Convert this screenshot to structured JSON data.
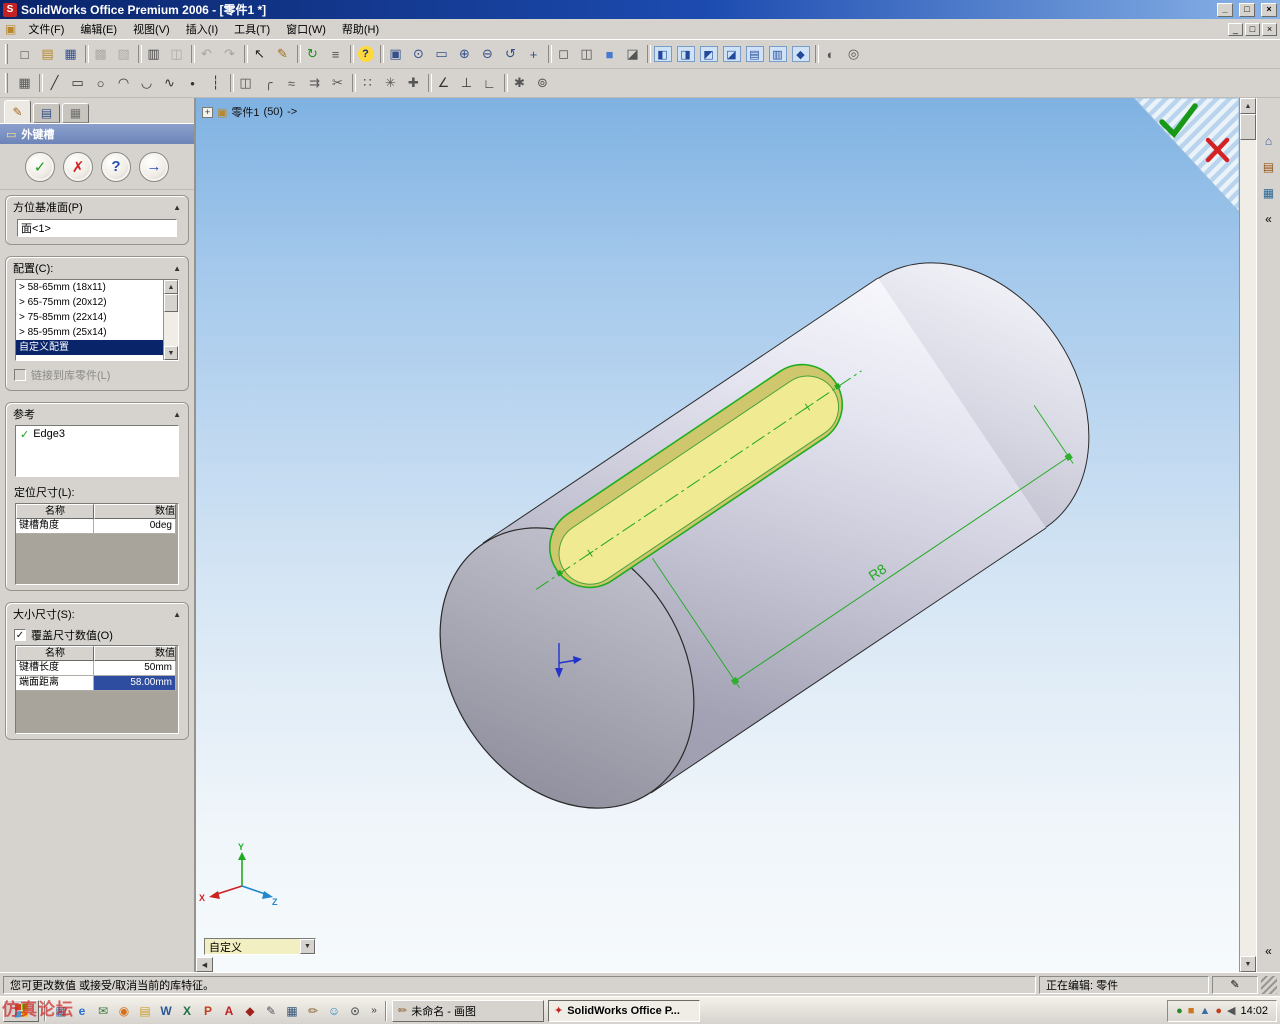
{
  "glyphs": {
    "up": "▲",
    "down": "▼",
    "left": "◀",
    "collapse": "▲",
    "dropdown": "▼",
    "check": "✓",
    "overflow": "»",
    "chevron": "«"
  },
  "window": {
    "title": "SolidWorks Office Premium 2006 - [零件1 *]",
    "icon_glyph": "S",
    "doc_icon_glyph": "▣",
    "controls": {
      "minimize": "_",
      "maximize": "□",
      "close": "×"
    }
  },
  "menu": {
    "items": [
      {
        "n": "menu-file",
        "label": "文件(F)"
      },
      {
        "n": "menu-edit",
        "label": "编辑(E)"
      },
      {
        "n": "menu-view",
        "label": "视图(V)"
      },
      {
        "n": "menu-insert",
        "label": "插入(I)"
      },
      {
        "n": "menu-tools",
        "label": "工具(T)"
      },
      {
        "n": "menu-window",
        "label": "窗口(W)"
      },
      {
        "n": "menu-help",
        "label": "帮助(H)"
      }
    ]
  },
  "toolbar_main": {
    "items": [
      {
        "n": "new-icon",
        "g": "□",
        "c": "#444444"
      },
      {
        "n": "open-icon",
        "g": "▤",
        "c": "#b8872b"
      },
      {
        "n": "save-icon",
        "g": "▦",
        "c": "#33518f"
      },
      {
        "cls": "sep"
      },
      {
        "n": "make-drawing-icon",
        "g": "▩",
        "c": "#666666",
        "cls": "dis"
      },
      {
        "n": "make-assembly-icon",
        "g": "▧",
        "c": "#666666",
        "cls": "dis"
      },
      {
        "cls": "sep"
      },
      {
        "n": "print-icon",
        "g": "▥",
        "c": "#444444"
      },
      {
        "n": "print-preview-icon",
        "g": "◫",
        "c": "#666666",
        "cls": "dis"
      },
      {
        "cls": "sep"
      },
      {
        "n": "undo-icon",
        "g": "↶",
        "c": "#555555",
        "cls": "dis"
      },
      {
        "n": "redo-icon",
        "g": "↷",
        "c": "#555555",
        "cls": "dis"
      },
      {
        "cls": "sep"
      },
      {
        "n": "select-icon",
        "g": "↖",
        "c": "#222222"
      },
      {
        "n": "sketch-icon",
        "g": "✎",
        "c": "#a06a1a"
      },
      {
        "cls": "sep"
      },
      {
        "n": "rebuild-icon",
        "g": "↻",
        "c": "#1f8f1f"
      },
      {
        "n": "options-icon",
        "g": "≡",
        "c": "#555555"
      },
      {
        "cls": "sep"
      },
      {
        "n": "help-icon",
        "g": "?",
        "c": "#14327a",
        "cls": "round"
      },
      {
        "cls": "sep"
      },
      {
        "n": "view-orientation-icon",
        "g": "▣",
        "c": "#35508a"
      },
      {
        "n": "zoom-fit-icon",
        "g": "⊙",
        "c": "#35508a"
      },
      {
        "n": "zoom-area-icon",
        "g": "▭",
        "c": "#35508a"
      },
      {
        "n": "zoom-in-out-icon",
        "g": "⊕",
        "c": "#35508a"
      },
      {
        "n": "zoom-selected-icon",
        "g": "⊖",
        "c": "#35508a"
      },
      {
        "n": "rotate-view-icon",
        "g": "↺",
        "c": "#35508a"
      },
      {
        "n": "pan-icon",
        "g": "+",
        "c": "#35508a"
      },
      {
        "cls": "sep"
      },
      {
        "n": "wireframe-icon",
        "g": "◻",
        "c": "#555555"
      },
      {
        "n": "hidden-lines-icon",
        "g": "◫",
        "c": "#555555"
      },
      {
        "n": "shaded-icon",
        "g": "■",
        "c": "#4a7ad0"
      },
      {
        "n": "shadows-icon",
        "g": "◪",
        "c": "#555555"
      },
      {
        "cls": "sep"
      },
      {
        "n": "view-front-icon",
        "g": "◧",
        "c": "#234a9a",
        "cls": "vcube"
      },
      {
        "n": "view-back-icon",
        "g": "◨",
        "c": "#234a9a",
        "cls": "vcube"
      },
      {
        "n": "view-left-icon",
        "g": "◩",
        "c": "#234a9a",
        "cls": "vcube"
      },
      {
        "n": "view-right-icon",
        "g": "◪",
        "c": "#234a9a",
        "cls": "vcube"
      },
      {
        "n": "view-top-icon",
        "g": "▤",
        "c": "#234a9a",
        "cls": "vcube"
      },
      {
        "n": "view-bottom-icon",
        "g": "▥",
        "c": "#234a9a",
        "cls": "vcube"
      },
      {
        "n": "view-iso-icon",
        "g": "◆",
        "c": "#234a9a",
        "cls": "vcube"
      },
      {
        "cls": "sep"
      },
      {
        "n": "section-view-icon",
        "g": "◐",
        "c": "#555555"
      },
      {
        "n": "camera-view-icon",
        "g": "◎",
        "c": "#555555"
      }
    ]
  },
  "toolbar_sketch": {
    "items": [
      {
        "n": "grid-icon",
        "g": "▦",
        "c": "#555555"
      },
      {
        "cls": "sep"
      },
      {
        "n": "line-icon",
        "g": "╱",
        "c": "#333333"
      },
      {
        "n": "rectangle-icon",
        "g": "▭",
        "c": "#333333"
      },
      {
        "n": "circle-icon",
        "g": "○",
        "c": "#333333"
      },
      {
        "n": "arc-icon",
        "g": "◠",
        "c": "#333333"
      },
      {
        "n": "tangent-arc-icon",
        "g": "◡",
        "c": "#333333"
      },
      {
        "n": "spline-icon",
        "g": "∿",
        "c": "#333333"
      },
      {
        "n": "point-icon",
        "g": "•",
        "c": "#333333"
      },
      {
        "n": "centerline-icon",
        "g": "┆",
        "c": "#333333"
      },
      {
        "cls": "sep"
      },
      {
        "n": "mirror-icon",
        "g": "◫",
        "c": "#555555"
      },
      {
        "n": "fillet-icon",
        "g": "╭",
        "c": "#555555"
      },
      {
        "n": "offset-icon",
        "g": "≈",
        "c": "#555555"
      },
      {
        "n": "convert-entities-icon",
        "g": "⇉",
        "c": "#555555"
      },
      {
        "n": "trim-icon",
        "g": "✂",
        "c": "#555555"
      },
      {
        "cls": "sep"
      },
      {
        "n": "linear-pattern-icon",
        "g": "∷",
        "c": "#555555"
      },
      {
        "n": "circular-pattern-icon",
        "g": "✳",
        "c": "#555555"
      },
      {
        "n": "move-entities-icon",
        "g": "✚",
        "c": "#555555"
      },
      {
        "cls": "sep"
      },
      {
        "n": "smart-dimension-icon",
        "g": "∠",
        "c": "#333333"
      },
      {
        "n": "add-relation-icon",
        "g": "⊥",
        "c": "#333333"
      },
      {
        "n": "display-relations-icon",
        "g": "∟",
        "c": "#333333"
      },
      {
        "cls": "sep"
      },
      {
        "n": "sketch-snaps-icon",
        "g": "✱",
        "c": "#555555"
      },
      {
        "n": "quick-snap-icon",
        "g": "⊚",
        "c": "#555555"
      }
    ]
  },
  "property_manager": {
    "title": "外键槽",
    "icon_glyph": "▭",
    "tabs": [
      {
        "n": "pm-tab-properties",
        "g": "✎",
        "c": "#a06a1a",
        "cls": "active"
      },
      {
        "n": "pm-tab-page2",
        "g": "▤",
        "c": "#35508a"
      },
      {
        "n": "pm-tab-page3",
        "g": "▦",
        "c": "#707070"
      }
    ],
    "actions": [
      {
        "n": "ok-button",
        "g": "✓",
        "c": "#1a9e1a"
      },
      {
        "n": "cancel-button",
        "g": "✗",
        "c": "#d42222"
      },
      {
        "n": "help-button",
        "g": "?",
        "c": "#2a50b4"
      },
      {
        "n": "pin-button",
        "g": "→",
        "c": "#2a50b4"
      }
    ],
    "orientation_group": {
      "title": "方位基准面(P)",
      "value": "面<1>"
    },
    "config_group": {
      "title": "配置(C):",
      "options": [
        {
          "label": "> 58-65mm  (18x11)"
        },
        {
          "label": "> 65-75mm  (20x12)"
        },
        {
          "label": "> 75-85mm  (22x14)"
        },
        {
          "label": "> 85-95mm  (25x14)"
        },
        {
          "label": "自定义配置",
          "cls": "selected"
        }
      ],
      "link_label": "链接到库零件(L)"
    },
    "reference_group": {
      "title": "参考",
      "value": "Edge3",
      "position_label": "定位尺寸(L):",
      "table": {
        "headers": {
          "name": "名称",
          "value": "数值"
        },
        "rows": [
          {
            "k": "键槽角度",
            "v": "0deg"
          }
        ]
      }
    },
    "size_group": {
      "title": "大小尺寸(S):",
      "override_label": "覆盖尺寸数值(O)",
      "table": {
        "headers": {
          "name": "名称",
          "value": "数值"
        },
        "rows": [
          {
            "k": "键槽长度",
            "v": "50mm"
          },
          {
            "k": "端面距离",
            "v": "58.00mm",
            "cls": "selected"
          }
        ]
      }
    }
  },
  "viewport": {
    "breadcrumb": {
      "plus": "+",
      "part_icon": "▣",
      "label": "零件1",
      "count": "(50)",
      "arrow": "->"
    },
    "dimension_label": "R8",
    "triad": {
      "x": "X",
      "y": "Y",
      "z": "Z"
    },
    "config_combo": "自定义"
  },
  "taskpane": {
    "icons": [
      {
        "n": "home-icon",
        "g": "⌂",
        "c": "#3a5a9a"
      },
      {
        "n": "design-library-icon",
        "g": "▤",
        "c": "#96561a"
      },
      {
        "n": "file-explorer-icon",
        "g": "▦",
        "c": "#2a6a9a"
      }
    ]
  },
  "status_bar": {
    "message": "您可更改数值 或接受/取消当前的库特征。",
    "editing": "正在编辑: 零件",
    "edit_icon": "✎"
  },
  "taskbar": {
    "flag": [
      {
        "bg": "#d43f2a"
      },
      {
        "bg": "#7fba00"
      },
      {
        "bg": "#3a99d8"
      },
      {
        "bg": "#ffb900"
      }
    ],
    "quick_launch": [
      {
        "n": "ql-show-desktop",
        "g": "▦",
        "c": "#3a6ea5"
      },
      {
        "n": "ql-internet-explorer",
        "g": "e",
        "c": "#2a6fd4"
      },
      {
        "n": "ql-outlook",
        "g": "✉",
        "c": "#3a7a3a"
      },
      {
        "n": "ql-media-player",
        "g": "◉",
        "c": "#d4701a"
      },
      {
        "n": "ql-folder",
        "g": "▤",
        "c": "#c8a030"
      },
      {
        "n": "ql-word",
        "g": "W",
        "c": "#2b579a"
      },
      {
        "n": "ql-excel",
        "g": "X",
        "c": "#1e7145"
      },
      {
        "n": "ql-powerpoint",
        "g": "P",
        "c": "#c43e1c"
      },
      {
        "n": "ql-acrobat",
        "g": "A",
        "c": "#c02020"
      },
      {
        "n": "ql-cad",
        "g": "◆",
        "c": "#a02020"
      },
      {
        "n": "ql-notepad",
        "g": "✎",
        "c": "#505560"
      },
      {
        "n": "ql-calculator",
        "g": "▦",
        "c": "#335577"
      },
      {
        "n": "ql-paint",
        "g": "✏",
        "c": "#865a2a"
      },
      {
        "n": "ql-messenger",
        "g": "☺",
        "c": "#2a8ac4"
      },
      {
        "n": "ql-search",
        "g": "⊙",
        "c": "#666666"
      }
    ],
    "tasks": [
      {
        "n": "task-paint",
        "icon": "✏",
        "icon_c": "#865a2a",
        "label": "未命名 - 画图"
      },
      {
        "n": "task-solidworks",
        "icon": "✦",
        "icon_c": "#c42222",
        "label": "SolidWorks Office P...",
        "cls": "active"
      }
    ],
    "tray_icons": [
      {
        "n": "tray-icon-1",
        "g": "●",
        "c": "#2a8a2a"
      },
      {
        "n": "tray-icon-2",
        "g": "■",
        "c": "#c87820"
      },
      {
        "n": "tray-icon-3",
        "g": "▲",
        "c": "#3a6ea5"
      },
      {
        "n": "tray-icon-4",
        "g": "●",
        "c": "#c43e1c"
      },
      {
        "n": "tray-volume",
        "g": "◀",
        "c": "#555555"
      }
    ],
    "clock": "14:02"
  },
  "watermark": "仿真论坛"
}
